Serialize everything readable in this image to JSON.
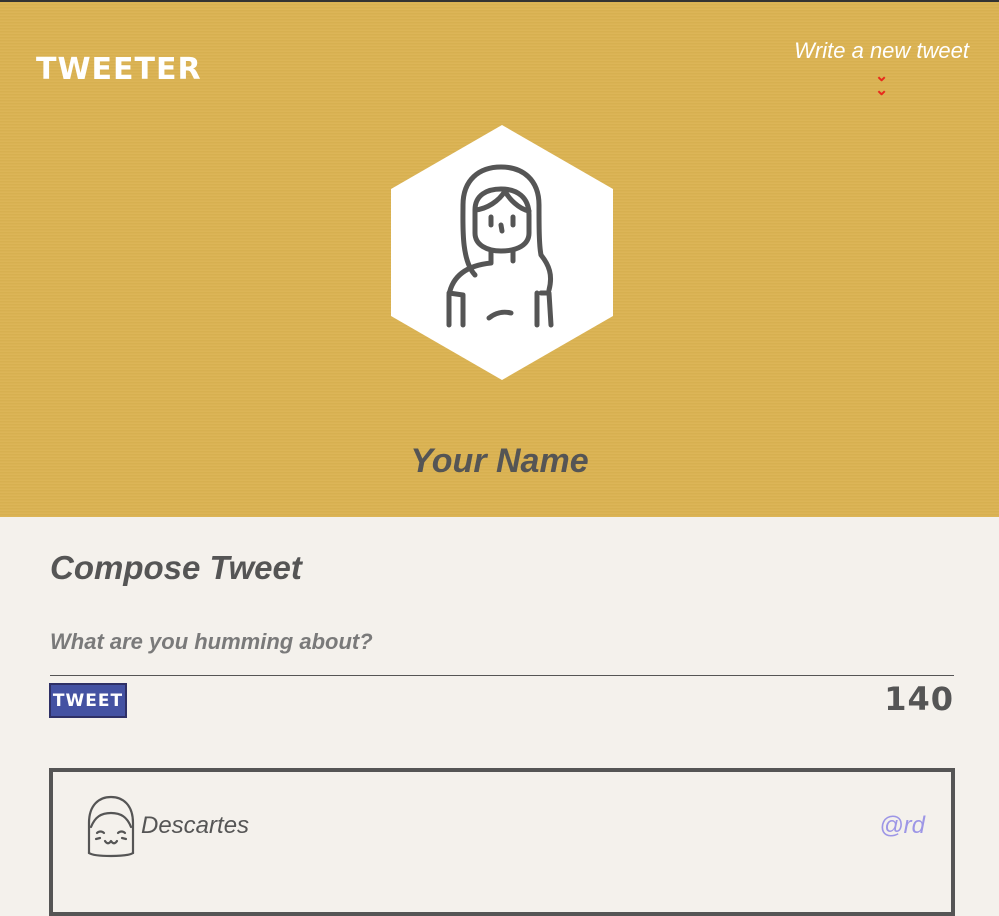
{
  "header": {
    "brand": "TWEETER",
    "compose_link": "Write a new tweet",
    "compose_link_icon": "chevron-double-down-icon",
    "profile_name": "Your Name"
  },
  "composer": {
    "title": "Compose Tweet",
    "placeholder": "What are you humming about?",
    "value": "",
    "button_label": "TWEET",
    "counter": "140"
  },
  "tweets": [
    {
      "name": "Descartes",
      "handle": "@rd"
    }
  ],
  "colors": {
    "header_bg": "#dbb352",
    "page_bg": "#f4f1ec",
    "text_dark": "#555555",
    "button": "#4452a2",
    "chevron": "#e8291c",
    "handle": "#9d96e6"
  }
}
